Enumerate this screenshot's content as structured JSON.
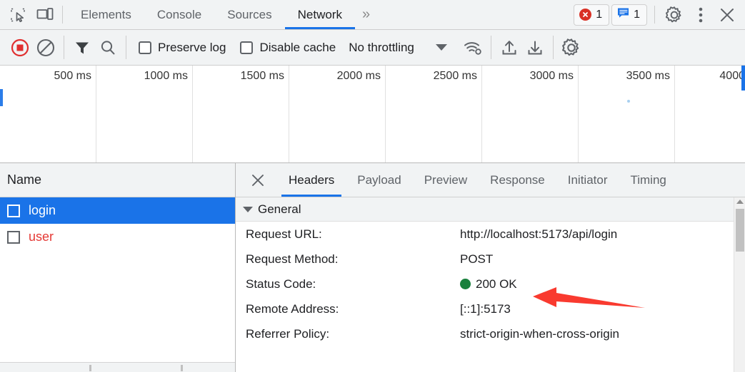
{
  "tabbar": {
    "inspect_icon": "inspect-cursor-icon",
    "device_icon": "device-toolbar-icon",
    "tabs": [
      {
        "label": "Elements",
        "active": false
      },
      {
        "label": "Console",
        "active": false
      },
      {
        "label": "Sources",
        "active": false
      },
      {
        "label": "Network",
        "active": true
      }
    ],
    "more_tabs": "»",
    "error_count": "1",
    "message_count": "1",
    "settings_icon": "gear-icon",
    "menu_icon": "kebab-menu-icon",
    "close_icon": "close-icon"
  },
  "nettoolbar": {
    "record_icon": "record-stop-icon",
    "clear_icon": "clear-icon",
    "filter_icon": "filter-funnel-icon",
    "search_icon": "search-icon",
    "preserve_log_label": "Preserve log",
    "preserve_log_checked": false,
    "disable_cache_label": "Disable cache",
    "disable_cache_checked": false,
    "throttling_value": "No throttling",
    "network_conditions_icon": "wifi-settings-icon",
    "import_icon": "import-upload-icon",
    "export_icon": "export-download-icon",
    "settings_icon": "gear-icon"
  },
  "overview": {
    "ticks": [
      "500 ms",
      "1000 ms",
      "1500 ms",
      "2000 ms",
      "2500 ms",
      "3000 ms",
      "3500 ms",
      "4000"
    ]
  },
  "requests": {
    "column_header": "Name",
    "rows": [
      {
        "name": "login",
        "selected": true,
        "error": false
      },
      {
        "name": "user",
        "selected": false,
        "error": true
      }
    ]
  },
  "details": {
    "close_icon": "close-icon",
    "tabs": [
      {
        "label": "Headers",
        "active": true
      },
      {
        "label": "Payload",
        "active": false
      },
      {
        "label": "Preview",
        "active": false
      },
      {
        "label": "Response",
        "active": false
      },
      {
        "label": "Initiator",
        "active": false
      },
      {
        "label": "Timing",
        "active": false
      }
    ],
    "section_title": "General",
    "fields": [
      {
        "key": "Request URL:",
        "value": "http://localhost:5173/api/login",
        "status": false
      },
      {
        "key": "Request Method:",
        "value": "POST",
        "status": false
      },
      {
        "key": "Status Code:",
        "value": "200 OK",
        "status": true
      },
      {
        "key": "Remote Address:",
        "value": "[::1]:5173",
        "status": false
      },
      {
        "key": "Referrer Policy:",
        "value": "strict-origin-when-cross-origin",
        "status": false
      }
    ]
  },
  "annotation": {
    "arrow_color": "#f93a2f",
    "points_at": "200 OK"
  }
}
